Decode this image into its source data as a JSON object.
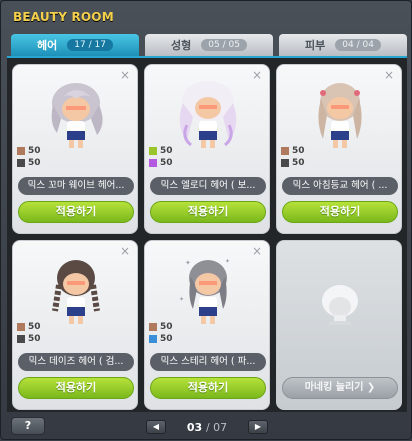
{
  "window": {
    "title": "BEAUTY ROOM"
  },
  "tabs": [
    {
      "label": "헤어",
      "count": "17 / 17",
      "active": true
    },
    {
      "label": "성형",
      "count": "05 / 05",
      "active": false
    },
    {
      "label": "피부",
      "count": "04 / 04",
      "active": false
    }
  ],
  "cards": [
    {
      "name": "믹스 꼬마 웨이브 헤어...",
      "stat1": "50",
      "stat2": "50",
      "color1": "#b07a5c",
      "color2": "#4a4a4a",
      "apply_label": "적용하기"
    },
    {
      "name": "믹스 엘로디 헤어 ( 보...",
      "stat1": "50",
      "stat2": "50",
      "color1": "#9ac52a",
      "color2": "#b35ae0",
      "apply_label": "적용하기"
    },
    {
      "name": "믹스 아침등교 헤어 ( ...",
      "stat1": "50",
      "stat2": "50",
      "color1": "#b07a5c",
      "color2": "#4a4a4a",
      "apply_label": "적용하기"
    },
    {
      "name": "믹스 데이즈 헤어 ( 검...",
      "stat1": "50",
      "stat2": "50",
      "color1": "#b07a5c",
      "color2": "#4a4a4a",
      "apply_label": "적용하기"
    },
    {
      "name": "믹스 스테리 헤어 ( 파...",
      "stat1": "50",
      "stat2": "50",
      "color1": "#b07a5c",
      "color2": "#3b8ed8",
      "apply_label": "적용하기"
    }
  ],
  "empty_slot": {
    "button_label": "마네킹 늘리기 ❯"
  },
  "footer": {
    "help_label": "?",
    "page_current": "03",
    "page_total": "/ 07",
    "prev_icon": "◀",
    "next_icon": "▶"
  },
  "icons": {
    "close": "×"
  }
}
